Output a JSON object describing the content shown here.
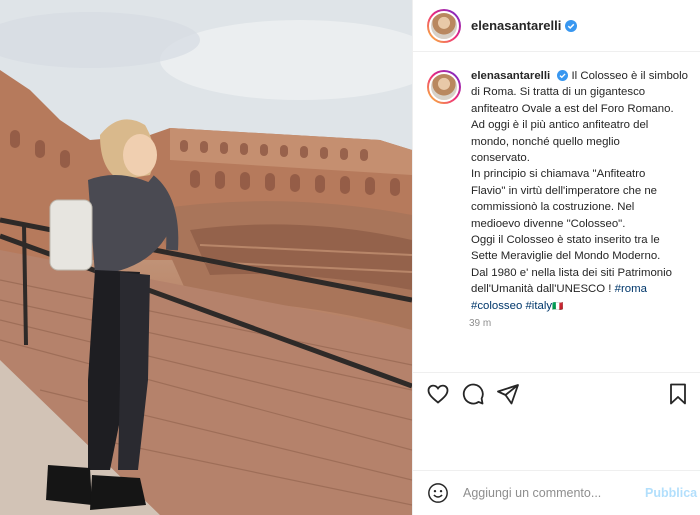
{
  "post": {
    "username": "elenasantarelli",
    "verified": true,
    "caption_lines": [
      "Il Colosseo è il simbolo",
      "di Roma. Si tratta di un gigantesco",
      "anfiteatro Ovale a est del Foro Romano.",
      "Ad oggi è il più antico anfiteatro del",
      "mondo, nonché quello meglio",
      "conservato.",
      "In principio si chiamava \"Anfiteatro",
      "Flavio\" in virtù dell'imperatore che ne",
      "commissionò la costruzione. Nel",
      "medioevo divenne \"Colosseo\".",
      "Oggi il Colosseo è stato inserito tra le",
      "Sette Meraviglie del Mondo Moderno.",
      "Dal 1980 e' nella lista dei siti Patrimonio",
      "dell'Umanità dall'UNESCO !"
    ],
    "hashtags": [
      "#roma",
      "#colosseo",
      "#italy"
    ],
    "flag_emoji": "🇮🇹",
    "timestamp": "39 m"
  },
  "comment_box": {
    "placeholder": "Aggiungi un commento...",
    "submit_label": "Pubblica"
  },
  "icons": {
    "like": "heart-icon",
    "comment": "comment-icon",
    "share": "share-icon",
    "save": "bookmark-icon",
    "emoji": "emoji-icon",
    "verified": "verified-badge-icon"
  },
  "colors": {
    "link": "#00376b",
    "verified_blue": "#3897f0",
    "publish_disabled": "#b2dffc",
    "muted": "#8e8e8e"
  }
}
